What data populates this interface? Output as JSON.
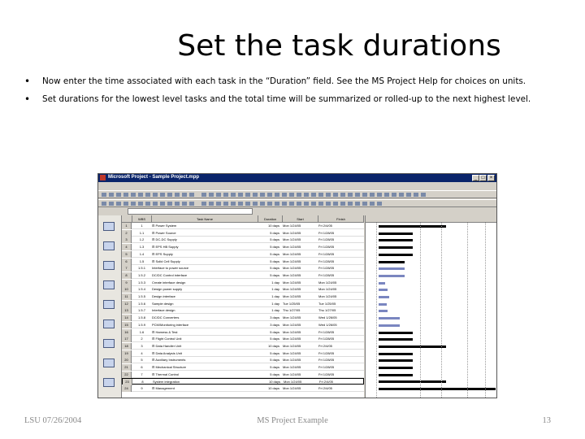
{
  "slide": {
    "title": "Set the task durations",
    "bullets": [
      "Now enter the time associated with each task in the “Duration” field.  See the MS Project Help for choices on units.",
      "Set durations for the lowest level tasks and the total time will be summarized or rolled-up to the next highest level."
    ],
    "footer_left": "LSU 07/26/2004",
    "footer_center": "MS Project Example",
    "footer_right": "13",
    "bullet_glyph": "•"
  },
  "screenshot": {
    "window_title": "Microsoft Project - Sample Project.mpp",
    "columns": [
      "",
      "WBS",
      "Task Name",
      "Duration",
      "Start",
      "Finish"
    ],
    "tasks": [
      {
        "id": "1",
        "wbs": "1",
        "name": "⊟ Power System",
        "duration": "10 days",
        "start": "Mon 1/24/05",
        "finish": "Fri 2/4/05",
        "bar": "sum",
        "b0": 0.1,
        "b1": 0.62
      },
      {
        "id": "2",
        "wbs": "1.1",
        "name": "⊟ Power Source",
        "duration": "5 days",
        "start": "Mon 1/24/05",
        "finish": "Fri 1/28/05",
        "bar": "sum",
        "b0": 0.1,
        "b1": 0.36
      },
      {
        "id": "3",
        "wbs": "1.2",
        "name": "⊟ DC-DC Supply",
        "duration": "5 days",
        "start": "Mon 1/24/05",
        "finish": "Fri 1/28/05",
        "bar": "sum",
        "b0": 0.1,
        "b1": 0.36
      },
      {
        "id": "4",
        "wbs": "1.3",
        "name": "⊟ EPS HB Supply",
        "duration": "5 days",
        "start": "Mon 1/24/05",
        "finish": "Fri 1/28/05",
        "bar": "sum",
        "b0": 0.1,
        "b1": 0.36
      },
      {
        "id": "5",
        "wbs": "1.4",
        "name": "⊟ EPS Supply",
        "duration": "5 days",
        "start": "Mon 1/24/05",
        "finish": "Fri 1/28/05",
        "bar": "sum",
        "b0": 0.1,
        "b1": 0.36
      },
      {
        "id": "6",
        "wbs": "1.5",
        "name": "⊟ Solid Cell Supply",
        "duration": "5 days",
        "start": "Mon 1/24/05",
        "finish": "Fri 1/28/05",
        "bar": "sum",
        "b0": 0.1,
        "b1": 0.3
      },
      {
        "id": "7",
        "wbs": "1.5.1",
        "name": "Interface to power source",
        "duration": "5 days",
        "start": "Mon 1/24/05",
        "finish": "Fri 1/28/05",
        "bar": "task",
        "b0": 0.1,
        "b1": 0.3
      },
      {
        "id": "8",
        "wbs": "1.5.2",
        "name": "DC/DC Control interface",
        "duration": "5 days",
        "start": "Mon 1/24/05",
        "finish": "Fri 1/28/05",
        "bar": "task",
        "b0": 0.1,
        "b1": 0.3
      },
      {
        "id": "9",
        "wbs": "1.5.3",
        "name": "Create interface design",
        "duration": "1 day",
        "start": "Mon 1/24/05",
        "finish": "Mon 1/24/05",
        "bar": "task",
        "b0": 0.1,
        "b1": 0.15
      },
      {
        "id": "10",
        "wbs": "1.5.4",
        "name": "Design power supply",
        "duration": "1 day",
        "start": "Mon 1/24/05",
        "finish": "Mon 1/24/05",
        "bar": "task",
        "b0": 0.1,
        "b1": 0.17
      },
      {
        "id": "11",
        "wbs": "1.5.5",
        "name": "Design interface",
        "duration": "1 day",
        "start": "Mon 1/24/05",
        "finish": "Mon 1/24/05",
        "bar": "task",
        "b0": 0.1,
        "b1": 0.18
      },
      {
        "id": "12",
        "wbs": "1.5.6",
        "name": "Sample design",
        "duration": "1 day",
        "start": "Tue 1/25/05",
        "finish": "Tue 1/25/05",
        "bar": "task",
        "b0": 0.1,
        "b1": 0.16
      },
      {
        "id": "13",
        "wbs": "1.5.7",
        "name": "Interface design",
        "duration": "1 day",
        "start": "Thu 1/27/05",
        "finish": "Thu 1/27/05",
        "bar": "task",
        "b0": 0.1,
        "b1": 0.17
      },
      {
        "id": "14",
        "wbs": "1.5.8",
        "name": "DC/DC Converters",
        "duration": "3 days",
        "start": "Mon 1/24/05",
        "finish": "Wed 1/26/05",
        "bar": "task",
        "b0": 0.1,
        "b1": 0.26
      },
      {
        "id": "15",
        "wbs": "1.5.9",
        "name": "PCM/Monitoring interface",
        "duration": "3 days",
        "start": "Mon 1/24/05",
        "finish": "Wed 1/26/05",
        "bar": "task",
        "b0": 0.1,
        "b1": 0.26
      },
      {
        "id": "16",
        "wbs": "1.6",
        "name": "⊟ Harness & Test",
        "duration": "5 days",
        "start": "Mon 1/24/05",
        "finish": "Fri 1/28/05",
        "bar": "sum",
        "b0": 0.1,
        "b1": 0.36
      },
      {
        "id": "17",
        "wbs": "2",
        "name": "⊟ Flight Control Unit",
        "duration": "5 days",
        "start": "Mon 1/24/05",
        "finish": "Fri 1/28/05",
        "bar": "sum",
        "b0": 0.1,
        "b1": 0.36
      },
      {
        "id": "18",
        "wbs": "3",
        "name": "⊟ Data Handler Unit",
        "duration": "10 days",
        "start": "Mon 1/24/05",
        "finish": "Fri 2/4/05",
        "bar": "sum",
        "b0": 0.1,
        "b1": 0.62
      },
      {
        "id": "19",
        "wbs": "4",
        "name": "⊟ Data Analysis Unit",
        "duration": "5 days",
        "start": "Mon 1/24/05",
        "finish": "Fri 1/28/05",
        "bar": "sum",
        "b0": 0.1,
        "b1": 0.36
      },
      {
        "id": "20",
        "wbs": "5",
        "name": "⊟ Auxiliary Instruments",
        "duration": "5 days",
        "start": "Mon 1/24/05",
        "finish": "Fri 1/28/05",
        "bar": "sum",
        "b0": 0.1,
        "b1": 0.36
      },
      {
        "id": "21",
        "wbs": "6",
        "name": "⊟ Mechanical Structure",
        "duration": "5 days",
        "start": "Mon 1/24/05",
        "finish": "Fri 1/28/05",
        "bar": "sum",
        "b0": 0.1,
        "b1": 0.36
      },
      {
        "id": "22",
        "wbs": "7",
        "name": "⊟ Thermal Control",
        "duration": "5 days",
        "start": "Mon 1/24/05",
        "finish": "Fri 1/28/05",
        "bar": "sum",
        "b0": 0.1,
        "b1": 0.36
      },
      {
        "id": "23",
        "wbs": "8",
        "name": "System integration",
        "duration": "10 days",
        "start": "Mon 1/24/05",
        "finish": "Fri 2/4/05",
        "bar": "sum",
        "b0": 0.1,
        "b1": 0.62
      },
      {
        "id": "24",
        "wbs": "9",
        "name": "⊟ Management",
        "duration": "10 days",
        "start": "Mon 1/24/05",
        "finish": "Fri 2/4/05",
        "bar": "sum",
        "b0": 0.1,
        "b1": 1.0
      }
    ]
  }
}
